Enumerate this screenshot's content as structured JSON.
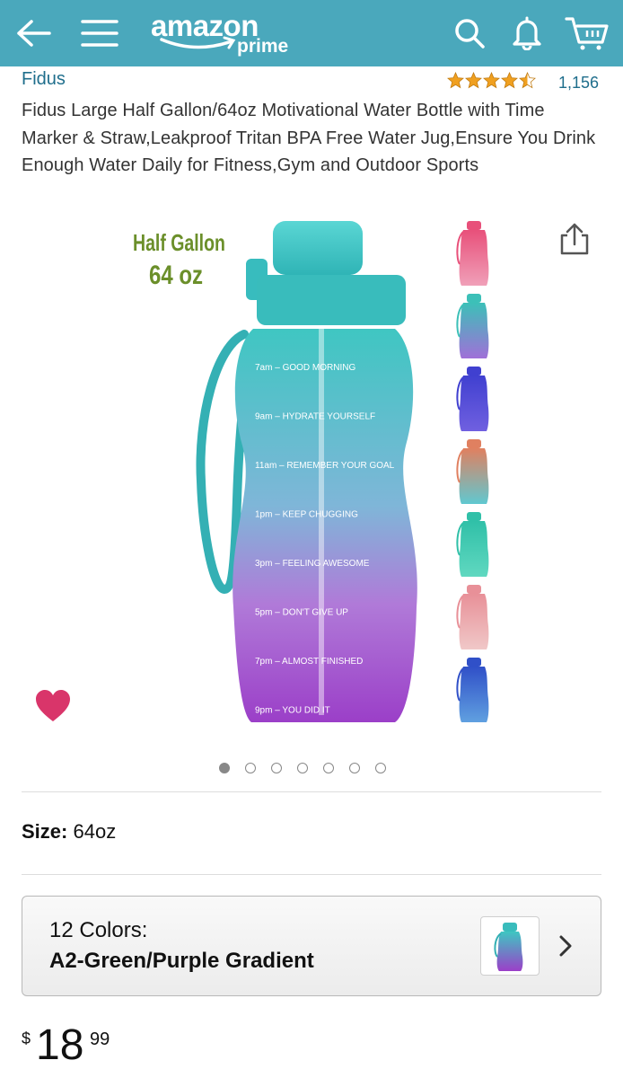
{
  "header": {
    "logo_main": "amazon",
    "logo_sub": "prime",
    "icons": [
      "back-arrow-icon",
      "hamburger-menu-icon",
      "search-icon",
      "bell-icon",
      "cart-icon"
    ],
    "bar_color": "#4aa8bc"
  },
  "product": {
    "brand": "Fidus",
    "rating": 4.5,
    "review_count": "1,156",
    "title": "Fidus Large Half Gallon/64oz Motivational Water Bottle with Time Marker & Straw,Leakproof Tritan BPA Free Water Jug,Ensure You Drink Enough Water Daily for Fitness,Gym and Outdoor Sports"
  },
  "image": {
    "label_line1": "Half Gallon",
    "label_line2": "64 oz",
    "markers": [
      {
        "time": "7am",
        "text": "GOOD MORNING"
      },
      {
        "time": "9am",
        "text": "HYDRATE YOURSELF"
      },
      {
        "time": "11am",
        "text": "REMEMBER YOUR GOAL"
      },
      {
        "time": "1pm",
        "text": "KEEP CHUGGING"
      },
      {
        "time": "3pm",
        "text": "FEELING AWESOME"
      },
      {
        "time": "5pm",
        "text": "DON'T GIVE UP"
      },
      {
        "time": "7pm",
        "text": "ALMOST FINISHED"
      },
      {
        "time": "9pm",
        "text": "YOU DID IT"
      }
    ],
    "dot_count": 7,
    "active_dot": 1,
    "thumbnail_colors": [
      [
        "#e8507a",
        "#f0a0b8"
      ],
      [
        "#3cc0b8",
        "#a070d8"
      ],
      [
        "#4040d0",
        "#7060e0"
      ],
      [
        "#e08060",
        "#60c8d0"
      ],
      [
        "#30c0a8",
        "#60d8c0"
      ],
      [
        "#e89098",
        "#f0c8c8"
      ],
      [
        "#3050c8",
        "#60a0e0"
      ]
    ]
  },
  "size": {
    "label": "Size:",
    "value": "64oz"
  },
  "color_selector": {
    "count_label": "12 Colors:",
    "selected": "A2-Green/Purple Gradient"
  },
  "price": {
    "currency": "$",
    "whole": "18",
    "fraction": "99"
  },
  "colors": {
    "link": "#1f6e8c",
    "heart": "#d9356a",
    "star": "#f0a020"
  }
}
